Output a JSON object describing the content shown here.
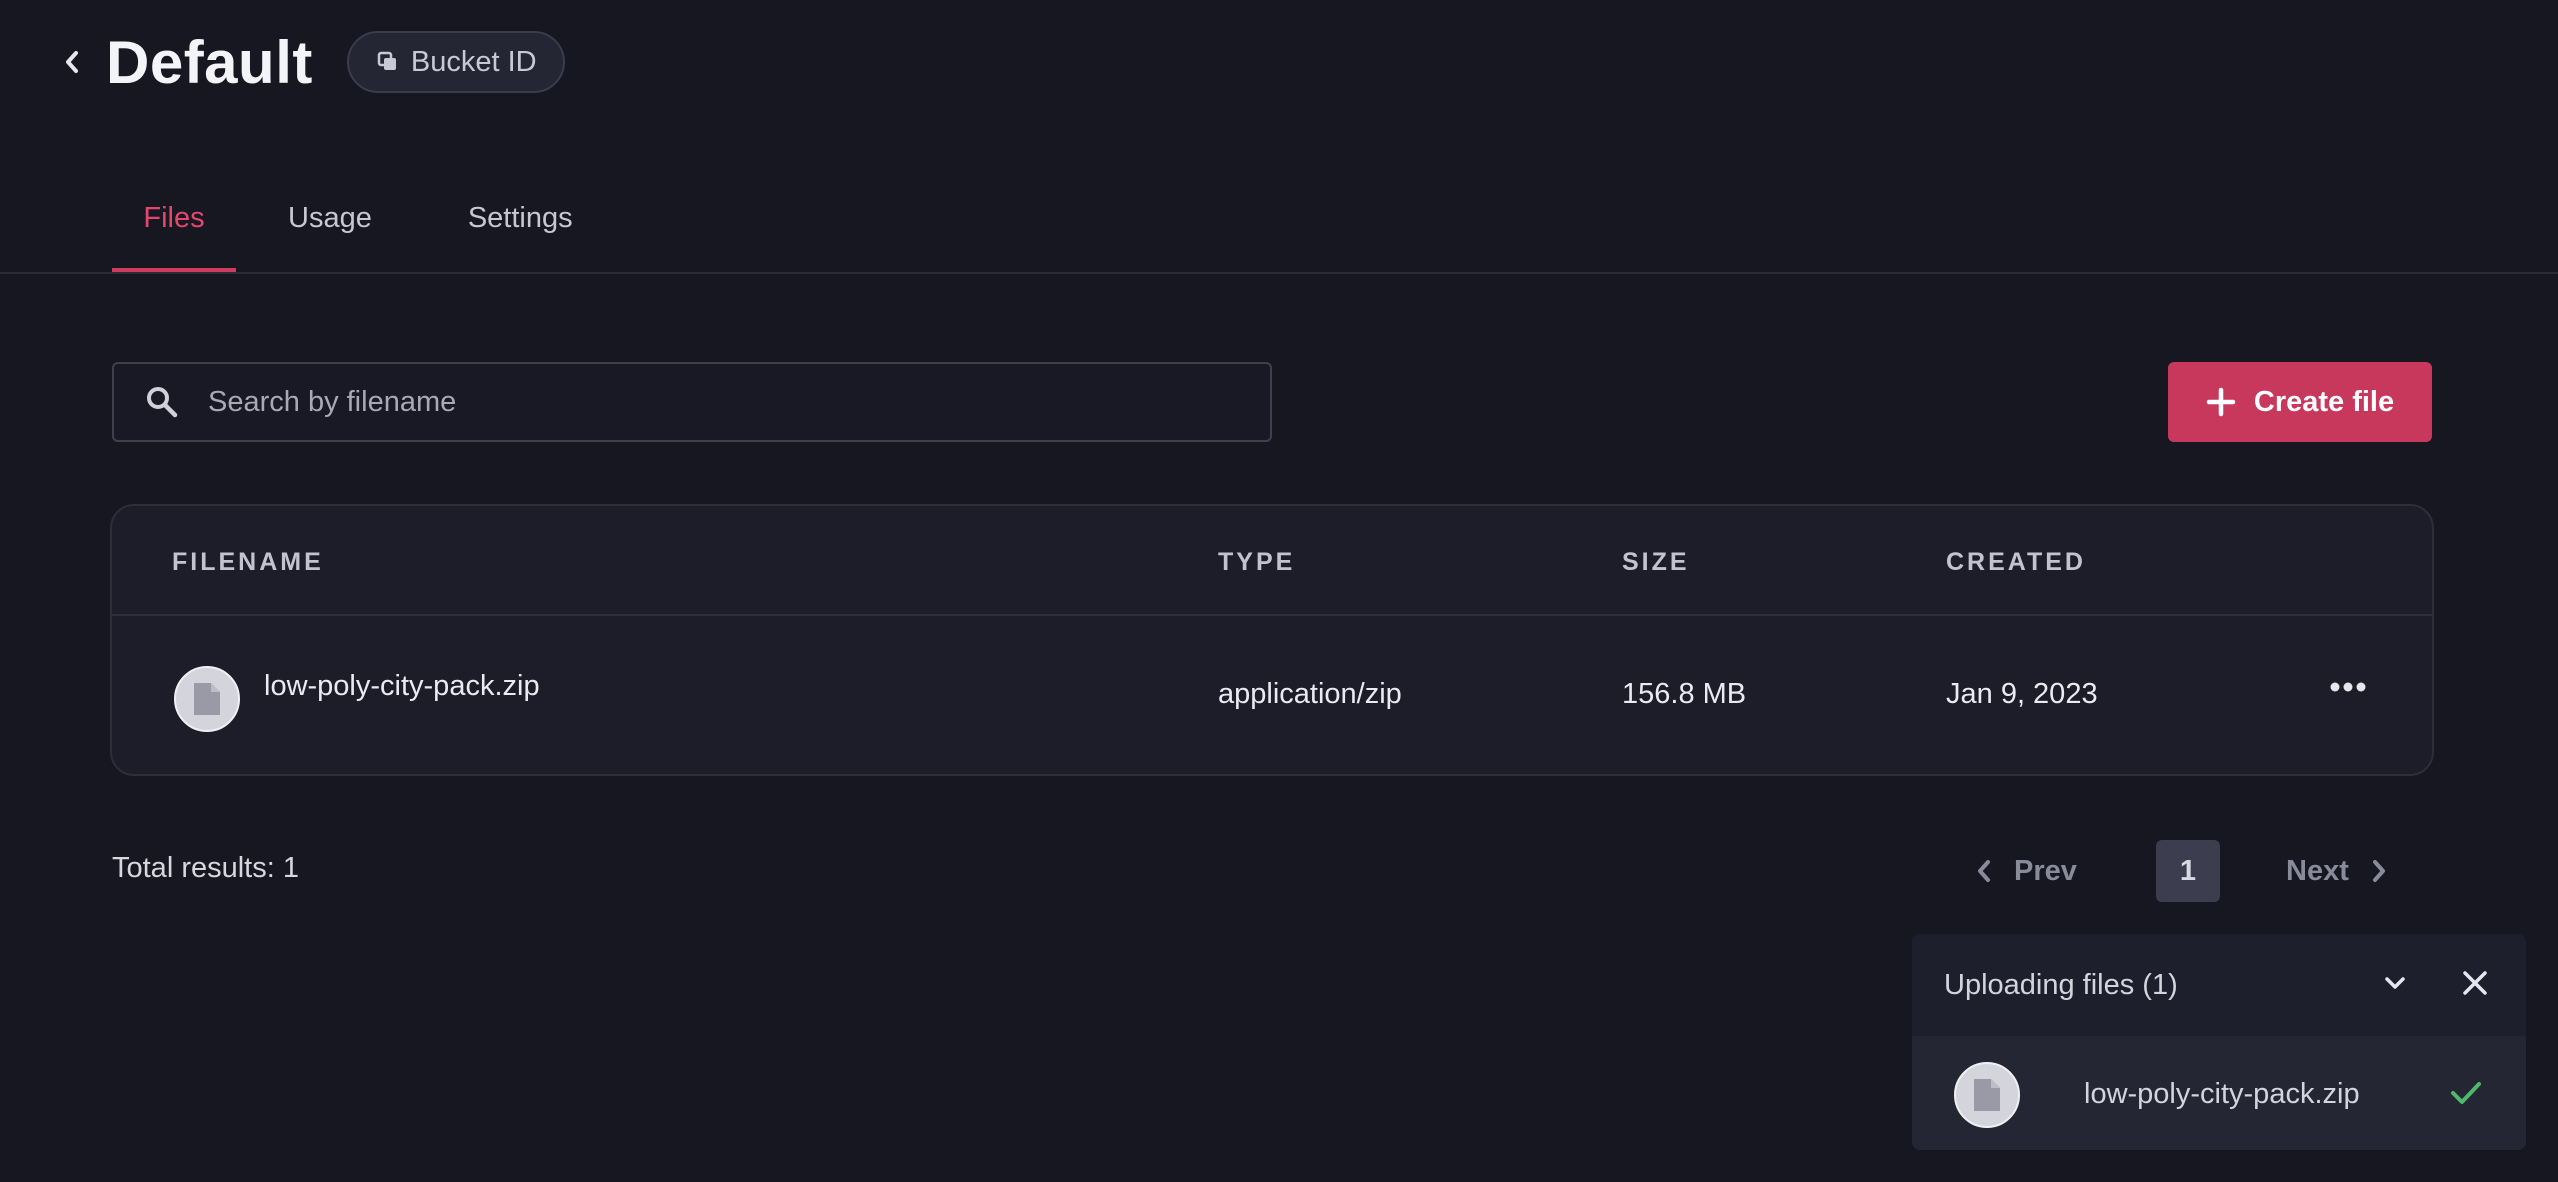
{
  "header": {
    "title": "Default",
    "bucket_id_label": "Bucket ID"
  },
  "tabs": [
    {
      "label": "Files",
      "active": true
    },
    {
      "label": "Usage",
      "active": false
    },
    {
      "label": "Settings",
      "active": false
    }
  ],
  "search": {
    "placeholder": "Search by filename",
    "value": ""
  },
  "create_button": {
    "label": "Create file"
  },
  "table": {
    "columns": [
      "FILENAME",
      "TYPE",
      "SIZE",
      "CREATED"
    ],
    "rows": [
      {
        "filename": "low-poly-city-pack.zip",
        "type": "application/zip",
        "size": "156.8 MB",
        "created": "Jan 9, 2023"
      }
    ]
  },
  "footer": {
    "total_results": "Total results: 1"
  },
  "pagination": {
    "prev_label": "Prev",
    "current_page": "1",
    "next_label": "Next"
  },
  "upload_panel": {
    "title": "Uploading files (1)",
    "items": [
      {
        "filename": "low-poly-city-pack.zip",
        "status": "complete"
      }
    ]
  },
  "icons": {
    "back": "chevron-left-icon",
    "copy": "copy-icon",
    "search": "search-icon",
    "plus": "plus-icon",
    "file": "file-icon",
    "more": "more-horizontal-icon",
    "prev": "chevron-left-icon",
    "next": "chevron-right-icon",
    "collapse": "chevron-down-icon",
    "close": "close-icon",
    "check": "check-icon"
  },
  "colors": {
    "background": "#171722",
    "accent": "#c7385c",
    "active_tab": "#e3476e",
    "success": "#4fb86a"
  }
}
